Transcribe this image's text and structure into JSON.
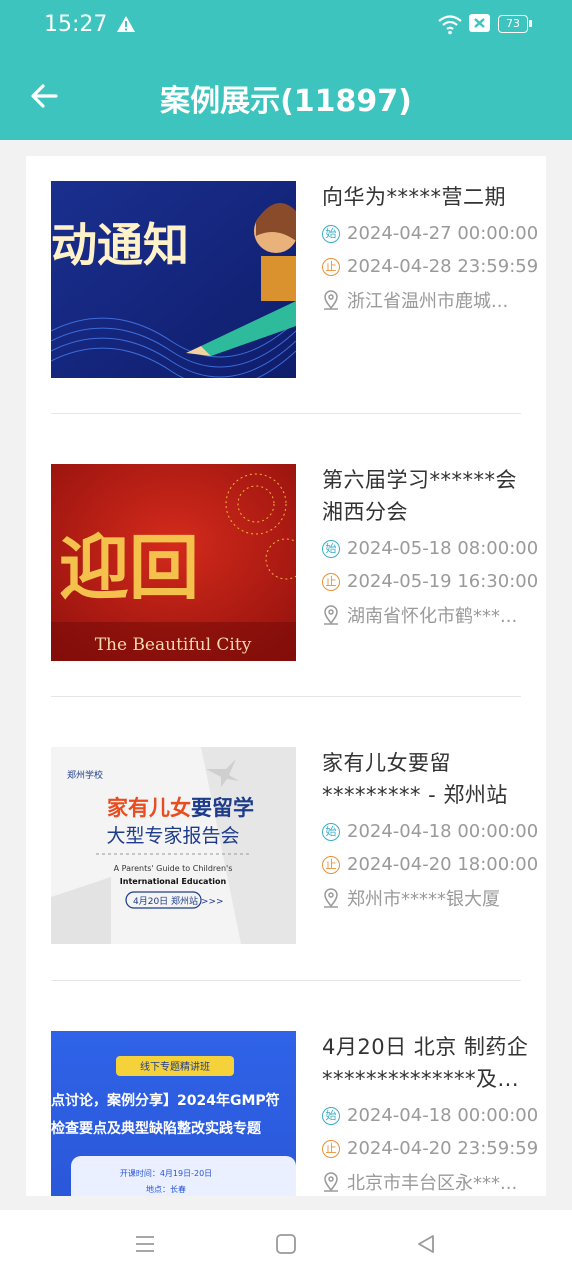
{
  "status": {
    "time": "15:27",
    "battery": "73"
  },
  "header": {
    "title": "案例展示(11897)"
  },
  "items": [
    {
      "title": "向华为*****营二期",
      "start": "2024-04-27 00:00:00",
      "end": "2024-04-28 23:59:59",
      "location": "浙江省温州市鹿城...",
      "thumb_text": "动通知"
    },
    {
      "title": "第六届学习******会湘西分会",
      "start": "2024-05-18 08:00:00",
      "end": "2024-05-19 16:30:00",
      "location": "湖南省怀化市鹤***...",
      "thumb_text": "迎回",
      "thumb_sub": "The Beautiful City"
    },
    {
      "title": "家有儿女要留********* - 郑州站",
      "start": "2024-04-18 00:00:00",
      "end": "2024-04-20 18:00:00",
      "location": "郑州市*****银大厦",
      "thumb_school": "郑州学校",
      "thumb_line1a": "家有儿女",
      "thumb_line1b": "要留学",
      "thumb_line2": "大型专家报告会",
      "thumb_en1": "A Parents' Guide to Children's",
      "thumb_en2": "International Education",
      "thumb_date": "4月20日 郑州站 >>>"
    },
    {
      "title": "4月20日 北京 制药企**************及...",
      "start": "2024-04-18 00:00:00",
      "end": "2024-04-20 23:59:59",
      "location": "北京市丰台区永***...",
      "thumb_badge": "线下专题精讲班",
      "thumb_line1": "点讨论，案例分享】2024年GMP符",
      "thumb_line2": "检查要点及典型缺陷整改实践专题",
      "thumb_time": "开课时间：4月19日-20日",
      "thumb_place": "地点：长春"
    }
  ],
  "labels": {
    "start_tag": "始",
    "end_tag": "止"
  },
  "colors": {
    "header": "#3dc4be",
    "start": "#3aaec6",
    "end": "#e6923a"
  }
}
